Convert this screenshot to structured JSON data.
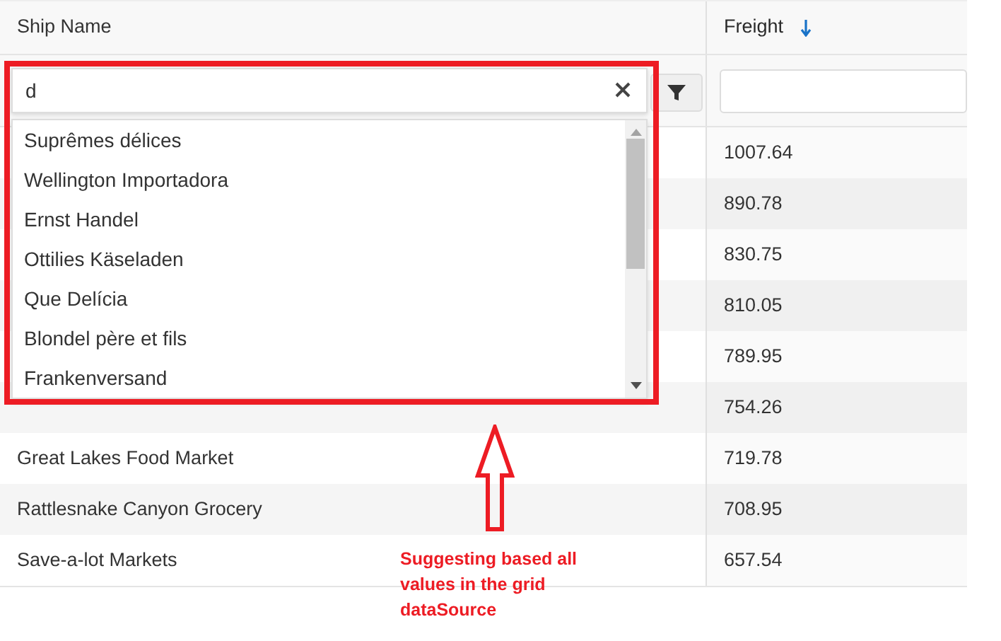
{
  "grid": {
    "columns": [
      {
        "label": "Ship Name",
        "sorted": false
      },
      {
        "label": "Freight",
        "sorted": true
      }
    ],
    "filter": {
      "value": "d"
    },
    "rows": [
      {
        "freight": "1007.64"
      },
      {
        "freight": "890.78"
      },
      {
        "freight": "830.75"
      },
      {
        "freight": "810.05"
      },
      {
        "freight": "789.95"
      },
      {
        "freight": "754.26"
      },
      {
        "ship_name": "Great Lakes Food Market",
        "freight": "719.78"
      },
      {
        "ship_name": "Rattlesnake Canyon Grocery",
        "freight": "708.95"
      },
      {
        "ship_name": "Save-a-lot Markets",
        "freight": "657.54"
      }
    ]
  },
  "suggestions": [
    "Suprêmes délices",
    "Wellington Importadora",
    "Ernst Handel",
    "Ottilies Käseladen",
    "Que Delícia",
    "Blondel père et fils",
    "Frankenversand"
  ],
  "annotation": {
    "text": "Suggesting based all values in the grid dataSource"
  }
}
